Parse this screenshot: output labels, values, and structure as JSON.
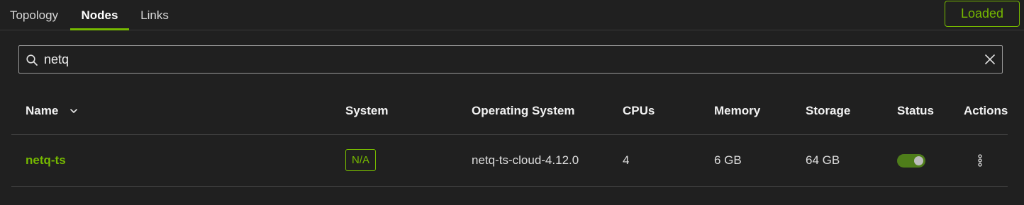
{
  "tabs": [
    {
      "label": "Topology",
      "active": false
    },
    {
      "label": "Nodes",
      "active": true
    },
    {
      "label": "Links",
      "active": false
    }
  ],
  "status_button": {
    "label": "Loaded"
  },
  "search": {
    "value": "netq",
    "icon": "search-icon",
    "clear_icon": "close-icon"
  },
  "table": {
    "columns": [
      "Name",
      "System",
      "Operating System",
      "CPUs",
      "Memory",
      "Storage",
      "Status",
      "Actions"
    ],
    "sort_icon": "chevron-down-icon",
    "rows": [
      {
        "name": "netq-ts",
        "system": "N/A",
        "operating_system": "netq-ts-cloud-4.12.0",
        "cpus": "4",
        "memory": "6 GB",
        "storage": "64 GB",
        "status_on": true,
        "actions_icon": "more-vertical-icon"
      }
    ]
  },
  "colors": {
    "accent": "#76b900",
    "background": "#202020",
    "toggle_track": "#4e7d1a"
  }
}
